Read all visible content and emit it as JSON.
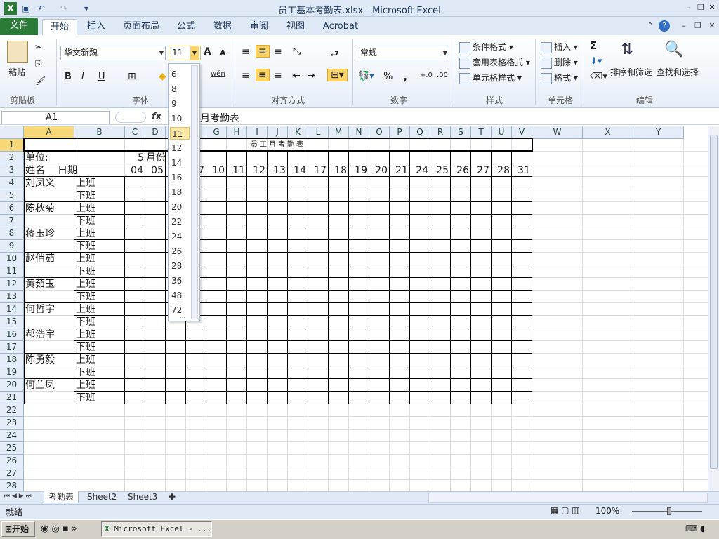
{
  "window": {
    "title": "员工基本考勤表.xlsx  -  Microsoft Excel"
  },
  "tabs": [
    {
      "label": "文件"
    },
    {
      "label": "开始"
    },
    {
      "label": "插入"
    },
    {
      "label": "页面布局"
    },
    {
      "label": "公式"
    },
    {
      "label": "数据"
    },
    {
      "label": "审阅"
    },
    {
      "label": "视图"
    },
    {
      "label": "Acrobat"
    }
  ],
  "ribbon": {
    "clipboard": {
      "paste": "粘贴",
      "group": "剪贴板"
    },
    "font": {
      "name": "华文新魏",
      "size": "11",
      "group": "字体",
      "bold": "B",
      "italic": "I",
      "underline": "U",
      "grow": "A",
      "shrink": "A",
      "wen": "wén"
    },
    "alignment": {
      "group": "对齐方式"
    },
    "number": {
      "format": "常规",
      "group": "数字",
      "percent": "%",
      "comma": ","
    },
    "styles": {
      "cond": "条件格式",
      "table": "套用表格格式",
      "cell": "单元格样式",
      "group": "样式"
    },
    "cells": {
      "insert": "插入",
      "delete": "删除",
      "format": "格式",
      "group": "单元格"
    },
    "editing": {
      "sum": "Σ",
      "sort": "排序和筛选",
      "find": "查找和选择",
      "group": "编辑"
    }
  },
  "formula_bar": {
    "name_box": "A1",
    "fx": "fx",
    "content": "月考勤表"
  },
  "font_size_options": [
    "6",
    "8",
    "9",
    "10",
    "11",
    "12",
    "14",
    "16",
    "18",
    "20",
    "22",
    "24",
    "26",
    "28",
    "36",
    "48",
    "72"
  ],
  "font_size_selected": "11",
  "columns": [
    "A",
    "B",
    "C",
    "D",
    "E",
    "F",
    "G",
    "H",
    "I",
    "J",
    "K",
    "L",
    "M",
    "N",
    "O",
    "P",
    "Q",
    "R",
    "S",
    "T",
    "U",
    "V",
    "W",
    "X",
    "Y"
  ],
  "rows": [
    "1",
    "2",
    "3",
    "4",
    "5",
    "6",
    "7",
    "8",
    "9",
    "10",
    "11",
    "12",
    "13",
    "14",
    "15",
    "16",
    "17",
    "18",
    "19",
    "20",
    "21",
    "22",
    "23",
    "24",
    "25",
    "26",
    "27",
    "28"
  ],
  "sheet": {
    "title": "员工月考勤表",
    "unit_label": "单位:",
    "month_value": "5",
    "month_label": "月份",
    "name_header": "姓名",
    "date_header": "日期",
    "dates": [
      "04",
      "05",
      "",
      "07",
      "10",
      "11",
      "12",
      "13",
      "14",
      "17",
      "18",
      "19",
      "20",
      "21",
      "24",
      "25",
      "26",
      "27",
      "28",
      "31"
    ],
    "employees": [
      {
        "name": "刘凤义",
        "am": "上班",
        "pm": "下班"
      },
      {
        "name": "陈秋菊",
        "am": "上班",
        "pm": "下班"
      },
      {
        "name": "蒋玉珍",
        "am": "上班",
        "pm": "下班"
      },
      {
        "name": "赵俏茹",
        "am": "上班",
        "pm": "下班"
      },
      {
        "name": "黄茹玉",
        "am": "上班",
        "pm": "下班"
      },
      {
        "name": "何哲宇",
        "am": "上班",
        "pm": "下班"
      },
      {
        "name": "郝浩宇",
        "am": "上班",
        "pm": "下班"
      },
      {
        "name": "陈勇毅",
        "am": "上班",
        "pm": "下班"
      },
      {
        "name": "何兰凤",
        "am": "上班",
        "pm": "下班"
      }
    ]
  },
  "sheet_tabs": [
    {
      "label": "考勤表"
    },
    {
      "label": "Sheet2"
    },
    {
      "label": "Sheet3"
    }
  ],
  "status": {
    "ready": "就绪",
    "zoom": "100%"
  },
  "taskbar": {
    "start": "开始",
    "excel_task": "Microsoft Excel - ..."
  }
}
